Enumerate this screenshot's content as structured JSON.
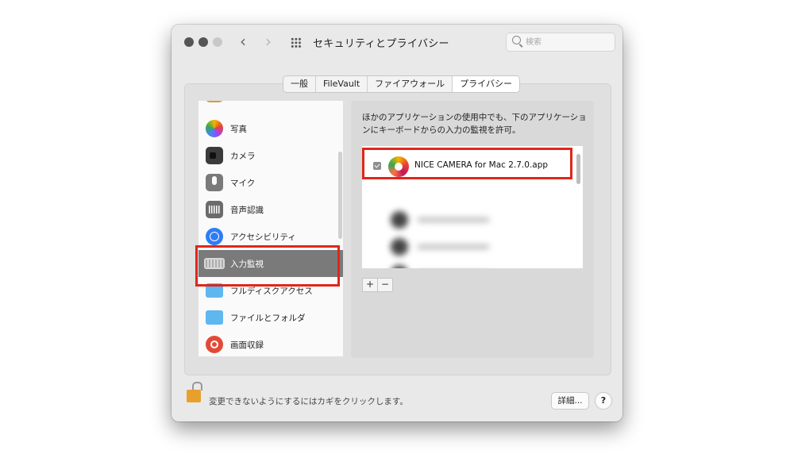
{
  "window": {
    "title": "セキュリティとプライバシー",
    "search": {
      "placeholder": "検索",
      "value": ""
    }
  },
  "toolbar": {
    "back_icon": "chevron-left-icon",
    "forward_icon": "chevron-right-icon",
    "grid_icon": "grid-icon"
  },
  "tabs": [
    {
      "label": "一般",
      "active": false
    },
    {
      "label": "FileVault",
      "active": false
    },
    {
      "label": "ファイアウォール",
      "active": false
    },
    {
      "label": "プライバシー",
      "active": true
    }
  ],
  "sidebar": {
    "items": [
      {
        "label": "写真",
        "icon": "photos-icon"
      },
      {
        "label": "カメラ",
        "icon": "camera-icon"
      },
      {
        "label": "マイク",
        "icon": "microphone-icon"
      },
      {
        "label": "音声認識",
        "icon": "speech-recognition-icon"
      },
      {
        "label": "アクセシビリティ",
        "icon": "accessibility-icon"
      },
      {
        "label": "入力監視",
        "icon": "keyboard-icon",
        "selected": true
      },
      {
        "label": "フルディスクアクセス",
        "icon": "folder-icon"
      },
      {
        "label": "ファイルとフォルダ",
        "icon": "folder-icon"
      },
      {
        "label": "画面収録",
        "icon": "screen-recording-icon"
      }
    ]
  },
  "panel": {
    "description": "ほかのアプリケーションの使用中でも、下のアプリケーションにキーボードからの入力の監視を許可。",
    "apps": [
      {
        "name": "NICE CAMERA for Mac 2.7.0.app",
        "checked": true
      }
    ],
    "add_label": "+",
    "remove_label": "−"
  },
  "footer": {
    "lock_text": "変更できないようにするにはカギをクリックします。",
    "advanced_label": "詳細...",
    "help_label": "?"
  },
  "colors": {
    "highlight": "#e0261b",
    "selected_row": "#7a7a7a"
  }
}
